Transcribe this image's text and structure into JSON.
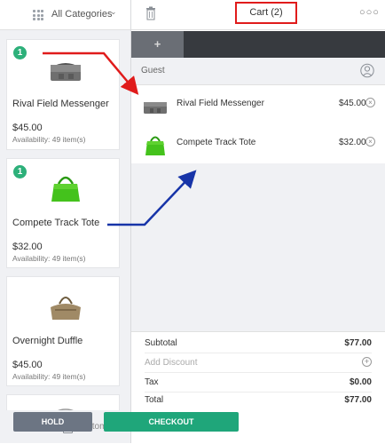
{
  "categories": {
    "selected": "All Categories"
  },
  "products": [
    {
      "name": "Rival Field Messenger",
      "price": "$45.00",
      "availability": "Availability: 49 item(s)",
      "badge": "1"
    },
    {
      "name": "Compete Track Tote",
      "price": "$32.00",
      "availability": "Availability: 49 item(s)",
      "badge": "1"
    },
    {
      "name": "Overnight Duffle",
      "price": "$45.00",
      "availability": "Availability: 49 item(s)",
      "badge": ""
    }
  ],
  "custom_sale": {
    "label": "Custom sale"
  },
  "cart": {
    "title": "Cart (2)",
    "add_tab_label": "+",
    "customer": "Guest",
    "items": [
      {
        "name": "Rival Field Messenger",
        "price": "$45.00"
      },
      {
        "name": "Compete Track Tote",
        "price": "$32.00"
      }
    ]
  },
  "totals": {
    "subtotal_label": "Subtotal",
    "subtotal": "$77.00",
    "discount_label": "Add Discount",
    "tax_label": "Tax",
    "tax": "$0.00",
    "total_label": "Total",
    "total": "$77.00"
  },
  "actions": {
    "hold_label": "HOLD",
    "checkout_label": "CHECKOUT"
  },
  "colors": {
    "accent_green": "#1fa67a",
    "badge_green": "#2db07a",
    "hold_gray": "#6c7583",
    "highlight_red": "#e01b1b",
    "arrow_blue": "#1734a8",
    "tab_bar": "#373a3f"
  },
  "icons": [
    "grid-icon",
    "chevron-down-icon",
    "trash-icon",
    "more-icon",
    "customer-icon",
    "remove-icon",
    "add-icon",
    "calculator-icon"
  ]
}
